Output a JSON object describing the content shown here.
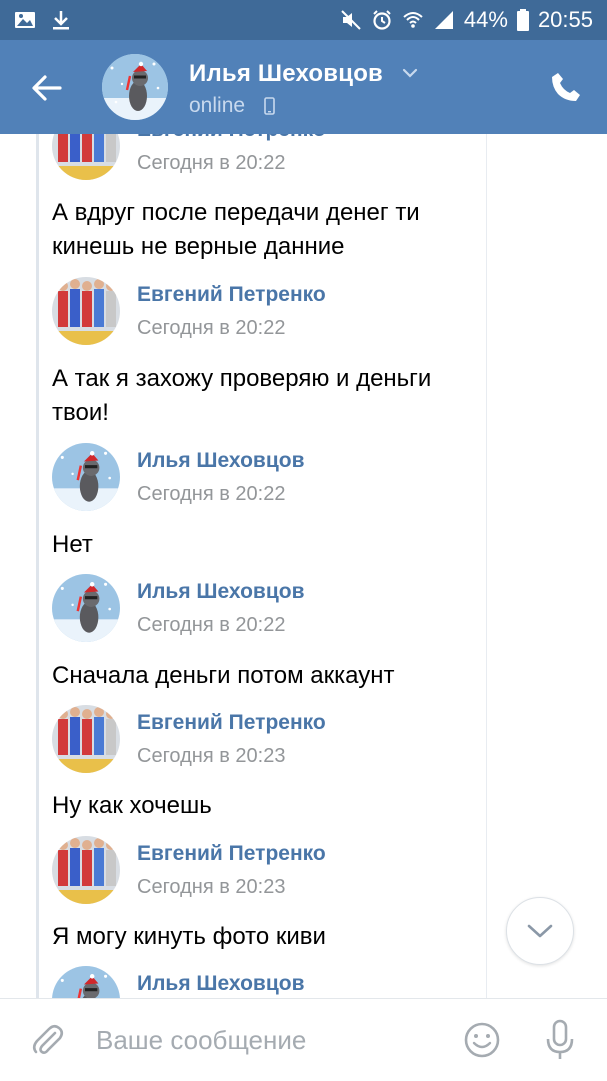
{
  "status_bar": {
    "battery": "44%",
    "time": "20:55"
  },
  "header": {
    "contact_name": "Илья Шеховцов",
    "presence": "online"
  },
  "messages": [
    {
      "author": "Евгений Петренко",
      "time": "Сегодня в 20:22",
      "avatar": "athletes",
      "text": ""
    },
    {
      "author": "",
      "time": "",
      "avatar": "",
      "text": "А вдруг после передачи денег ти кинешь не верные данние"
    },
    {
      "author": "Евгений Петренко",
      "time": "Сегодня в 20:22",
      "avatar": "athletes",
      "text": "А так я захожу проверяю и деньги твои!"
    },
    {
      "author": "Илья Шеховцов",
      "time": "Сегодня в 20:22",
      "avatar": "raccoon",
      "text": "Нет"
    },
    {
      "author": "Илья Шеховцов",
      "time": "Сегодня в 20:22",
      "avatar": "raccoon",
      "text": "Сначала деньги потом аккаунт"
    },
    {
      "author": "Евгений Петренко",
      "time": "Сегодня в 20:23",
      "avatar": "athletes",
      "text": "Ну как хочешь"
    },
    {
      "author": "Евгений Петренко",
      "time": "Сегодня в 20:23",
      "avatar": "athletes",
      "text": "Я могу кинуть фото киви"
    },
    {
      "author": "Илья Шеховцов",
      "time": "",
      "avatar": "raccoon",
      "text": ""
    }
  ],
  "composer": {
    "placeholder": "Ваше сообщение"
  }
}
